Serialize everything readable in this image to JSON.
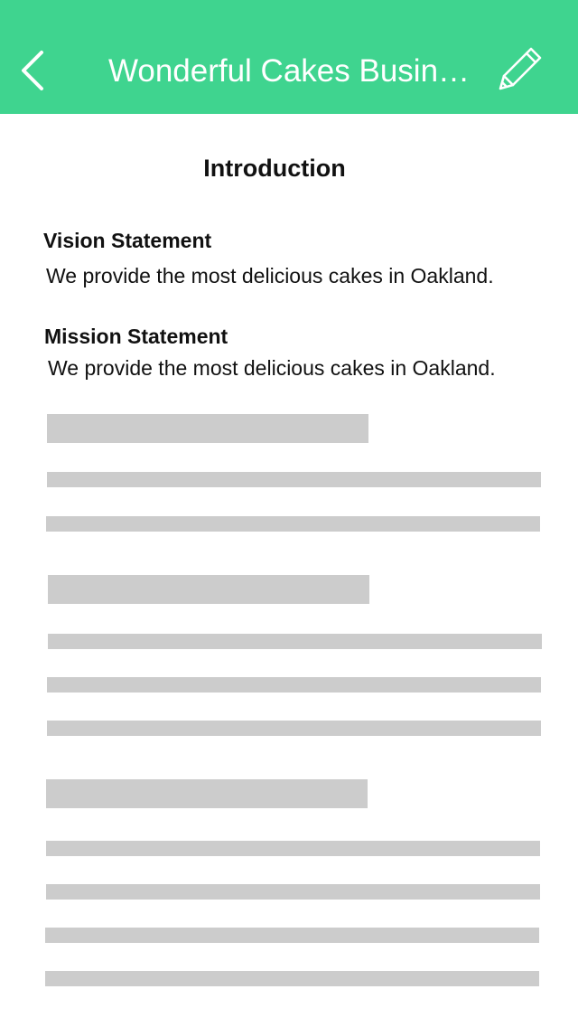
{
  "header": {
    "title": "Wonderful Cakes Busin…",
    "background_color": "#3fd48f",
    "back_icon": "chevron-left-icon",
    "edit_icon": "pencil-icon"
  },
  "content": {
    "section_title": "Introduction",
    "vision": {
      "label": "Vision Statement",
      "text": "We provide the most delicious cakes in Oakland."
    },
    "mission": {
      "label": "Mission Statement",
      "text": "We provide the most delicious cakes in Oakland."
    }
  },
  "placeholder_color": "#cccccc"
}
